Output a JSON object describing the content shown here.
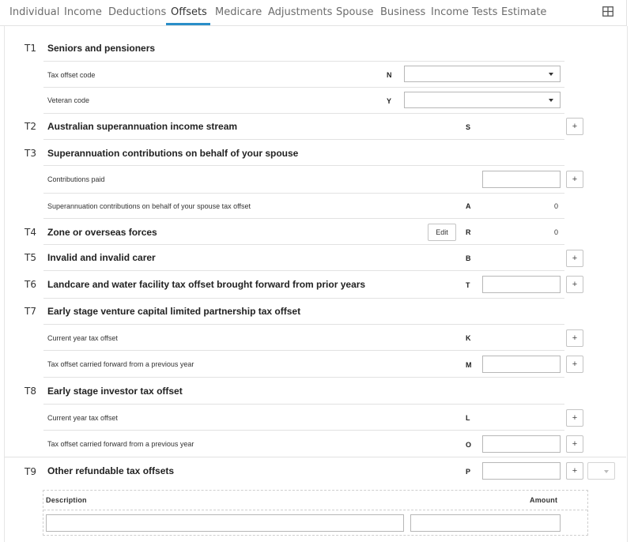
{
  "tabs": [
    {
      "label": "Individual"
    },
    {
      "label": "Income"
    },
    {
      "label": "Deductions"
    },
    {
      "label": "Offsets",
      "active": true
    },
    {
      "label": "Medicare"
    },
    {
      "label": "Adjustments"
    },
    {
      "label": "Spouse"
    },
    {
      "label": "Business"
    },
    {
      "label": "Income Tests"
    },
    {
      "label": "Estimate"
    }
  ],
  "sections": {
    "t1": {
      "num": "T1",
      "title": "Seniors and pensioners",
      "tax_offset_code": {
        "label": "Tax offset code",
        "code": "N",
        "value": ""
      },
      "veteran_code": {
        "label": "Veteran code",
        "code": "Y",
        "value": ""
      }
    },
    "t2": {
      "num": "T2",
      "title": "Australian superannuation income stream",
      "code": "S"
    },
    "t3": {
      "num": "T3",
      "title": "Superannuation contributions on behalf of your spouse",
      "contributions_paid": {
        "label": "Contributions paid",
        "value": ""
      },
      "offset": {
        "label": "Superannuation contributions on behalf of your spouse tax offset",
        "code": "A",
        "value": "0"
      }
    },
    "t4": {
      "num": "T4",
      "title": "Zone or overseas forces",
      "edit_label": "Edit",
      "code": "R",
      "value": "0"
    },
    "t5": {
      "num": "T5",
      "title": "Invalid and invalid carer",
      "code": "B"
    },
    "t6": {
      "num": "T6",
      "title": "Landcare and water facility tax offset brought forward from prior years",
      "code": "T",
      "value": ""
    },
    "t7": {
      "num": "T7",
      "title": "Early stage venture capital limited partnership tax offset",
      "current": {
        "label": "Current year tax offset",
        "code": "K"
      },
      "carried": {
        "label": "Tax offset carried forward from a previous year",
        "code": "M",
        "value": ""
      }
    },
    "t8": {
      "num": "T8",
      "title": "Early stage investor tax offset",
      "current": {
        "label": "Current year tax offset",
        "code": "L"
      },
      "carried": {
        "label": "Tax offset carried forward from a previous year",
        "code": "O",
        "value": ""
      }
    },
    "t9": {
      "num": "T9",
      "title": "Other refundable tax offsets",
      "code": "P",
      "value": "",
      "columns": {
        "description": "Description",
        "amount": "Amount"
      },
      "row": {
        "description": "",
        "amount": ""
      }
    }
  },
  "plus_label": "+",
  "colors": {
    "accent": "#2a8ec8",
    "border": "#b7b7b7",
    "divider": "#e2e2e2"
  }
}
